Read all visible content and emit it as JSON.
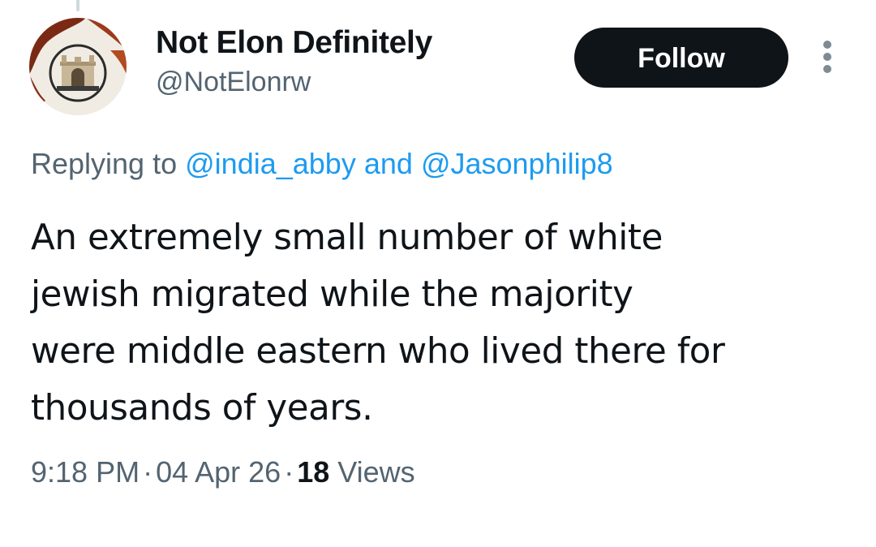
{
  "author": {
    "display_name": "Not Elon Definitely",
    "handle": "@NotElonrw",
    "avatar_icon": "gateway-of-india-photo"
  },
  "follow_label": "Follow",
  "more_icon": "vertical-ellipsis-icon",
  "reply_context": {
    "prefix": "Replying to",
    "mentions": [
      "@india_abby",
      "@Jasonphilip8"
    ],
    "joiner": "and"
  },
  "tweet": {
    "lines": [
      "An extremely small number of white",
      "jewish migrated while the majority",
      "were middle eastern who lived there for",
      "thousands of years."
    ]
  },
  "meta": {
    "time": "9:18 PM",
    "separator": "·",
    "date": "04 Apr 26",
    "views_count": "18",
    "views_label": "Views"
  },
  "colors": {
    "text_primary": "#0f1419",
    "text_secondary": "#536471",
    "link": "#1d9bf0",
    "button_bg": "#0f1419",
    "button_text": "#ffffff"
  }
}
